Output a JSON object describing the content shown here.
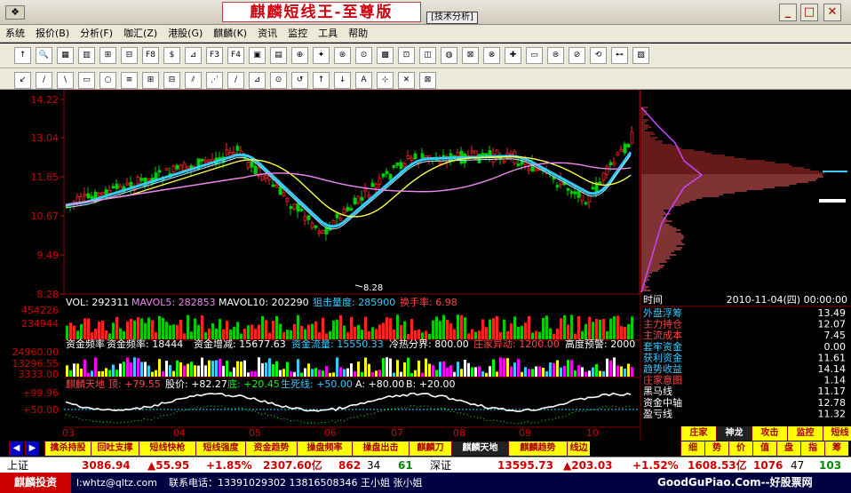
{
  "window": {
    "title": "麒麟短线王-至尊版",
    "subtitle": "[技术分析]",
    "sys_icon": "❖",
    "min": "_",
    "restore": "□",
    "close": "✕"
  },
  "menu": [
    "系统",
    "报价(B)",
    "分析(F)",
    "咖汇(Z)",
    "港股(G)",
    "麒麟(K)",
    "资讯",
    "监控",
    "工具",
    "帮助"
  ],
  "toolbar1": [
    "↑",
    "🔍",
    "▦",
    "▥",
    "⊞",
    "⊟",
    "F8",
    "$",
    "⊿",
    "F3",
    "F4",
    "▣",
    "▤",
    "⊕",
    "✦",
    "⊛",
    "⊙",
    "▩",
    "⊡",
    "◫",
    "◍",
    "⊠",
    "⊗",
    "✚",
    "▭",
    "⊜",
    "⊘",
    "⟲",
    "⊷",
    "▧"
  ],
  "toolbar2": [
    "↙",
    "/",
    "\\",
    "▭",
    "○",
    "≡",
    "⊞",
    "⊟",
    "⫽",
    "⋰",
    "/",
    "⊿",
    "⊙",
    "↺",
    "↑",
    "↓",
    "A",
    "⊹",
    "✕",
    "⊠"
  ],
  "price_axis": [
    "14.22",
    "13.04",
    "11.85",
    "10.67",
    "9.49",
    "8.28"
  ],
  "low_marker": "8.28",
  "vol_header": {
    "vol": "VOL: 292311",
    "mavol5": "MAVOL5: 282853",
    "mavol10": "MAVOL10: 202290",
    "snipe": "狙击量度: 285900",
    "turnover": "换手率: 6.98"
  },
  "vol_axis": [
    "454226",
    "234944"
  ],
  "fund_header": {
    "a": "资金频率",
    "b": "资金频率: 18444",
    "c": "资金增减: 15677.63",
    "d": "资金流量: 15550.33",
    "e": "冷热分界: 800.00",
    "f": "庄家异动: 1200.00",
    "g": "高度预警: 2000"
  },
  "fund_axis": [
    "24960.00",
    "13296.55",
    "3333.00"
  ],
  "qilin_header": {
    "name": "麒麟天地",
    "top": "顶: +79.55",
    "price": "股价: +82.27",
    "bottom": "底: +20.45",
    "life": "生死线: +50.00",
    "a": "A: +80.00",
    "b": "B: +20.00"
  },
  "qilin_axis": [
    "+99.96",
    "+50.00"
  ],
  "months": [
    "03",
    "04",
    "05",
    "06",
    "07",
    "08",
    "09",
    "10"
  ],
  "chip_panel": {
    "time_label": "时间",
    "time_value": "2010-11-04(四) 00:00:00"
  },
  "right_rows": [
    {
      "label": "外盘浮筹",
      "value": "13.49"
    },
    {
      "label": "主力持仓",
      "value": "12.07"
    },
    {
      "label": "主流成本",
      "value": "7.45"
    },
    {
      "label": "套牢资金",
      "value": "0.00"
    },
    {
      "label": "获利资金",
      "value": "11.61"
    },
    {
      "label": "趋势收益",
      "value": "14.14"
    },
    {
      "label": "庄家意图",
      "value": "1.14"
    },
    {
      "label": "黑马线",
      "value": "11.17"
    },
    {
      "label": "资金中轴",
      "value": "12.78"
    },
    {
      "label": "盈亏线",
      "value": "11.32"
    }
  ],
  "bottom_tabs": [
    "擒杀持股",
    "回吐支撑",
    "短线快枪",
    "短线强度",
    "资金趋势",
    "操盘频率",
    "操盘出击",
    "麒麟刀",
    "麒麟天地",
    "麒麟趋势",
    "线边"
  ],
  "right_tabs1": [
    "庄家",
    "神龙",
    "攻击",
    "监控",
    "短线"
  ],
  "right_tabs2": [
    "细",
    "势",
    "价",
    "值",
    "盘",
    "指",
    "筹"
  ],
  "status": {
    "sh_name": "上证",
    "sh_idx": "3086.94",
    "sh_chg": "▲55.95",
    "sh_pct": "+1.85%",
    "sh_amt": "2307.60亿",
    "sh_up": "862",
    "sh_flat": "34",
    "sh_down": "61",
    "sz_name": "深证",
    "sz_idx": "13595.73",
    "sz_chg": "▲203.03",
    "sz_pct": "+1.52%",
    "sz_amt": "1608.53亿",
    "sz_up": "1076",
    "sz_flat": "47",
    "sz_down": "103"
  },
  "footer": {
    "brand": "麒麟投资",
    "email": "l:whtz@qltz.com",
    "phone": "联系电话：13391029302  13816508346 王小姐 张小姐",
    "watermark": "GoodGuPiao.Com--好股票网"
  }
}
